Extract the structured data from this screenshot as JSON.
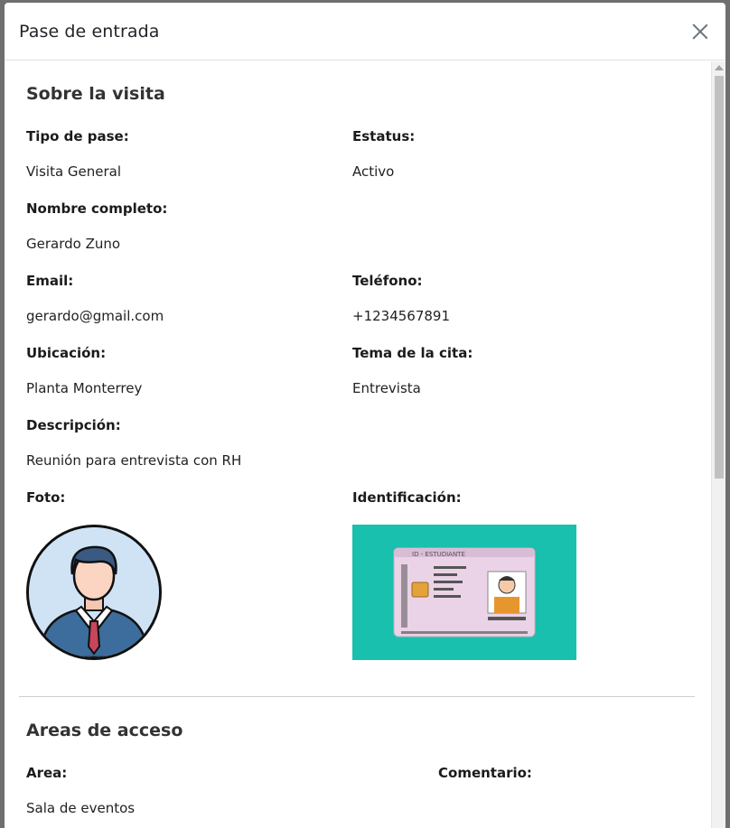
{
  "modal": {
    "title": "Pase de entrada"
  },
  "visit": {
    "section_title": "Sobre la visita",
    "tipo_label": "Tipo de pase:",
    "tipo_value": "Visita General",
    "estatus_label": "Estatus:",
    "estatus_value": "Activo",
    "nombre_label": "Nombre completo:",
    "nombre_value": "Gerardo Zuno",
    "email_label": "Email:",
    "email_value": "gerardo@gmail.com",
    "telefono_label": "Teléfono:",
    "telefono_value": "+1234567891",
    "ubicacion_label": "Ubicación:",
    "ubicacion_value": "Planta Monterrey",
    "tema_label": "Tema de la cita:",
    "tema_value": "Entrevista",
    "descripcion_label": "Descripción:",
    "descripcion_value": "Reunión para entrevista con RH",
    "foto_label": "Foto:",
    "identificacion_label": "Identificación:",
    "id_card_text": "ID - ESTUDIANTE"
  },
  "access": {
    "section_title": "Areas de acceso",
    "area_label": "Area:",
    "comentario_label": "Comentario:",
    "rows": [
      {
        "area": "Sala de eventos"
      }
    ]
  }
}
